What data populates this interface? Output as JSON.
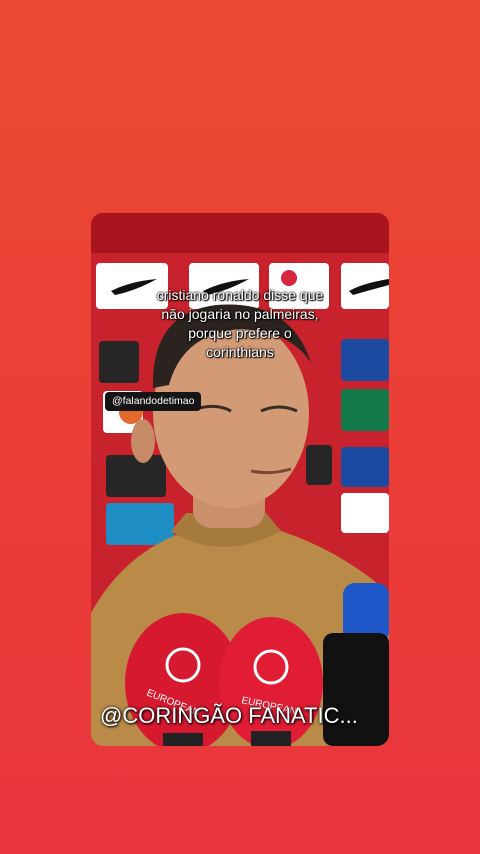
{
  "video": {
    "caption": "cristiano ronaldo disse que\nnão jogaria no palmeiras,\nporque prefere o\ncorinthians",
    "handle_tag": "@falandodetimao",
    "watermark": "@CORINGÃO FANATIC..."
  },
  "colors": {
    "page_background": "#ea3f36",
    "backdrop_red": "#c8232c",
    "jacket": "#b98a48"
  }
}
